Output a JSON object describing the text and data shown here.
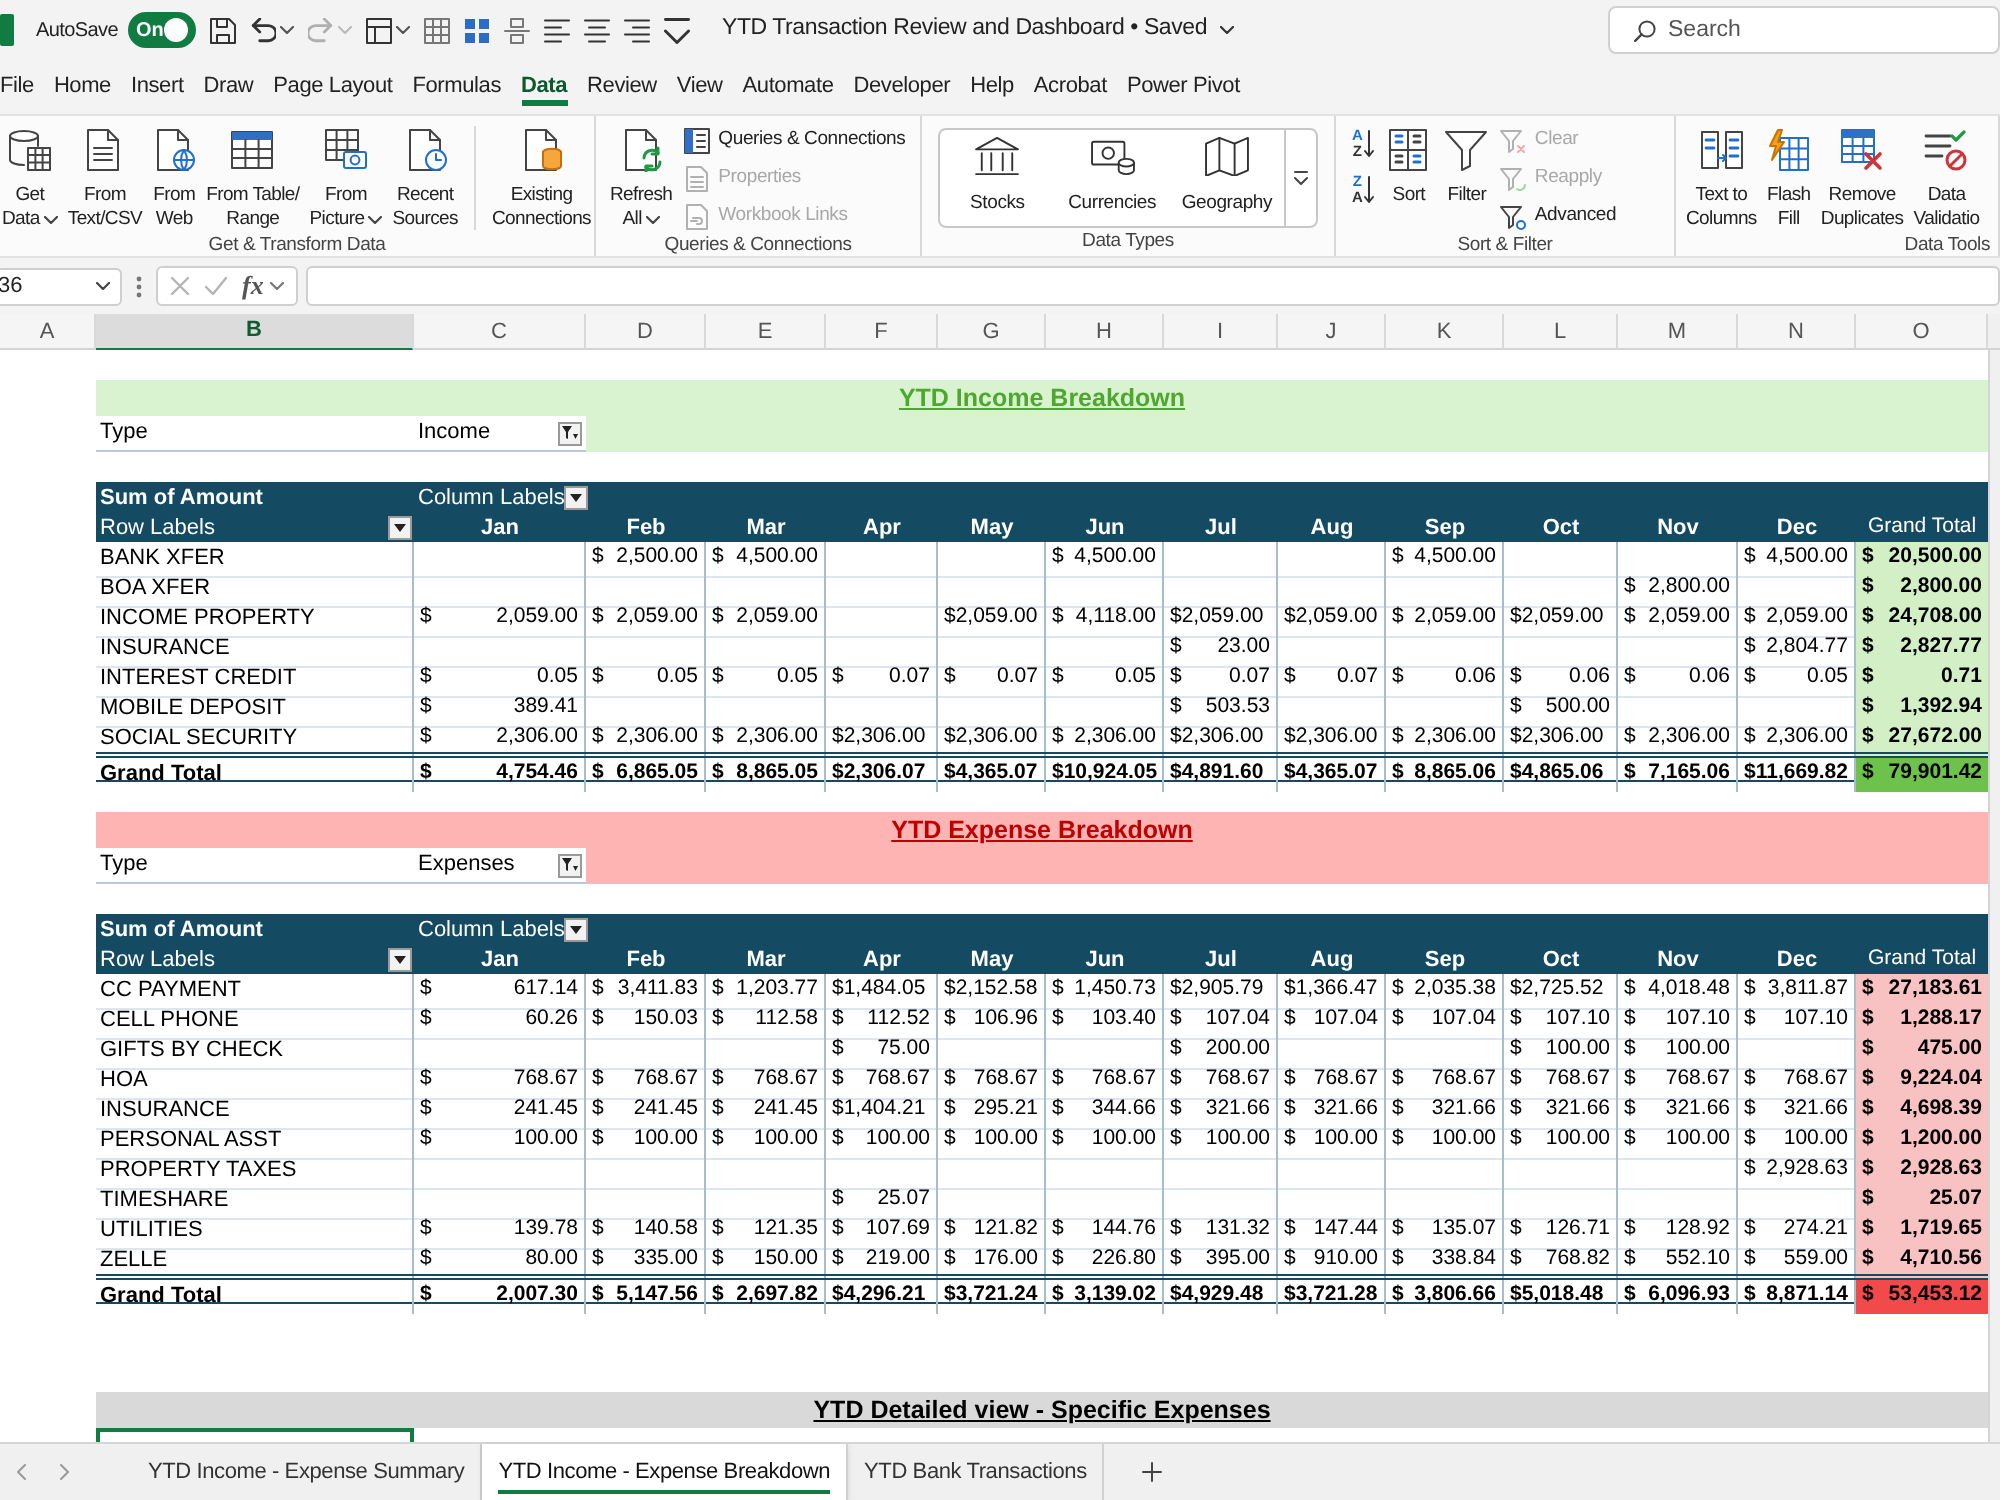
{
  "title_bar": {
    "autosave": {
      "label": "AutoSave",
      "on": true,
      "state_text": "On"
    },
    "quick_access": [
      {
        "dropdown": false,
        "disabled": false
      },
      {
        "dropdown": true,
        "disabled": false
      },
      {
        "dropdown": true,
        "disabled": true
      },
      {
        "dropdown": true,
        "disabled": false
      },
      {
        "dropdown": false,
        "disabled": false
      },
      {
        "dropdown": false,
        "disabled": false
      },
      {
        "dropdown": false,
        "disabled": false
      },
      {
        "dropdown": false,
        "disabled": false
      },
      {
        "dropdown": false,
        "disabled": false
      },
      {
        "dropdown": false,
        "disabled": false
      },
      {
        "dropdown": false,
        "disabled": false
      }
    ],
    "title": "YTD Transaction Review and Dashboard • Saved",
    "search": {
      "placeholder": "Search"
    }
  },
  "menu_tabs": [
    {
      "label": "File",
      "selected": false
    },
    {
      "label": "Home",
      "selected": false
    },
    {
      "label": "Insert",
      "selected": false
    },
    {
      "label": "Draw",
      "selected": false
    },
    {
      "label": "Page Layout",
      "selected": false
    },
    {
      "label": "Formulas",
      "selected": false
    },
    {
      "label": "Data",
      "selected": true
    },
    {
      "label": "Review",
      "selected": false
    },
    {
      "label": "View",
      "selected": false
    },
    {
      "label": "Automate",
      "selected": false
    },
    {
      "label": "Developer",
      "selected": false
    },
    {
      "label": "Help",
      "selected": false
    },
    {
      "label": "Acrobat",
      "selected": false
    },
    {
      "label": "Power Pivot",
      "selected": false
    }
  ],
  "ribbon": {
    "groups": [
      {
        "label": "Get & Transform Data",
        "items": [
          {
            "kind": "large",
            "lines": [
              "Get",
              "Data"
            ],
            "dropdown": true
          },
          {
            "kind": "large",
            "lines": [
              "From",
              "Text/CSV"
            ],
            "dropdown": false
          },
          {
            "kind": "large",
            "lines": [
              "From",
              "Web"
            ],
            "dropdown": false
          },
          {
            "kind": "large",
            "lines": [
              "From Table/",
              "Range"
            ],
            "dropdown": false
          },
          {
            "kind": "large",
            "lines": [
              "From",
              "Picture"
            ],
            "dropdown": true
          },
          {
            "kind": "large",
            "lines": [
              "Recent",
              "Sources"
            ],
            "dropdown": false
          },
          {
            "kind": "separator"
          },
          {
            "kind": "large",
            "lines": [
              "Existing",
              "Connections"
            ],
            "dropdown": false
          }
        ]
      },
      {
        "label": "Queries & Connections",
        "items": [
          {
            "kind": "large",
            "lines": [
              "Refresh",
              "All"
            ],
            "dropdown": true
          },
          {
            "kind": "stack",
            "buttons": [
              {
                "label": "Queries & Connections",
                "disabled": false
              },
              {
                "label": "Properties",
                "disabled": true
              },
              {
                "label": "Workbook Links",
                "disabled": true
              }
            ]
          }
        ]
      },
      {
        "label": "Data Types",
        "items": [
          {
            "kind": "gallery",
            "options": [
              "Stocks",
              "Currencies",
              "Geography"
            ]
          }
        ]
      },
      {
        "label": "Sort & Filter",
        "items": [
          {
            "kind": "sort_pair",
            "buttons": [
              {
                "top": "A",
                "bottom": "Z"
              },
              {
                "top": "Z",
                "bottom": "A"
              }
            ]
          },
          {
            "kind": "large",
            "lines": [
              "Sort"
            ],
            "dropdown": false
          },
          {
            "kind": "large",
            "lines": [
              "Filter"
            ],
            "dropdown": false
          },
          {
            "kind": "stack",
            "buttons": [
              {
                "label": "Clear",
                "disabled": true
              },
              {
                "label": "Reapply",
                "disabled": true
              },
              {
                "label": "Advanced",
                "disabled": false
              }
            ]
          }
        ]
      },
      {
        "label": "Data Tools",
        "items": [
          {
            "kind": "large",
            "lines": [
              "Text to",
              "Columns"
            ],
            "dropdown": false
          },
          {
            "kind": "large",
            "lines": [
              "Flash",
              "Fill"
            ],
            "dropdown": false
          },
          {
            "kind": "large",
            "lines": [
              "Remove",
              "Duplicates"
            ],
            "dropdown": false
          },
          {
            "kind": "large",
            "lines": [
              "Data",
              "Validatio"
            ],
            "dropdown": false
          }
        ]
      }
    ]
  },
  "formula_bar": {
    "name_box": "36",
    "cancel_disabled": true,
    "enter_disabled": true,
    "function_label": "fx"
  },
  "column_headers": [
    {
      "label": "A",
      "selected": false
    },
    {
      "label": "B",
      "selected": true
    },
    {
      "label": "C",
      "selected": false
    },
    {
      "label": "D",
      "selected": false
    },
    {
      "label": "E",
      "selected": false
    },
    {
      "label": "F",
      "selected": false
    },
    {
      "label": "G",
      "selected": false
    },
    {
      "label": "H",
      "selected": false
    },
    {
      "label": "I",
      "selected": false
    },
    {
      "label": "J",
      "selected": false
    },
    {
      "label": "K",
      "selected": false
    },
    {
      "label": "L",
      "selected": false
    },
    {
      "label": "M",
      "selected": false
    },
    {
      "label": "N",
      "selected": false
    },
    {
      "label": "O",
      "selected": false
    }
  ],
  "sections": [
    {
      "kind": "income",
      "title": "YTD Income Breakdown",
      "filter": {
        "label": "Type",
        "value": "Income"
      },
      "pivot": {
        "value_label": "Sum of Amount",
        "column_labels": "Column Labels",
        "row_labels": "Row Labels",
        "columns": [
          "Jan",
          "Feb",
          "Mar",
          "Apr",
          "May",
          "Jun",
          "Jul",
          "Aug",
          "Sep",
          "Oct",
          "Nov",
          "Dec",
          "Grand Total"
        ],
        "rows": [
          {
            "label": "BANK XFER",
            "cells": [
              null,
              "$ 2,500.00",
              "$ 4,500.00",
              null,
              null,
              "$ 4,500.00",
              null,
              null,
              "$ 4,500.00",
              null,
              null,
              "$ 4,500.00",
              "$ 20,500.00"
            ]
          },
          {
            "label": "BOA XFER",
            "cells": [
              null,
              null,
              null,
              null,
              null,
              null,
              null,
              null,
              null,
              null,
              "$ 2,800.00",
              null,
              "$ 2,800.00"
            ]
          },
          {
            "label": "INCOME PROPERTY",
            "cells": [
              "$ 2,059.00",
              "$ 2,059.00",
              "$ 2,059.00",
              null,
              "$2,059.00",
              "$ 4,118.00",
              "$2,059.00",
              "$2,059.00",
              "$ 2,059.00",
              "$2,059.00",
              "$ 2,059.00",
              "$ 2,059.00",
              "$ 24,708.00"
            ]
          },
          {
            "label": "INSURANCE",
            "cells": [
              null,
              null,
              null,
              null,
              null,
              null,
              "$ 23.00",
              null,
              null,
              null,
              null,
              "$ 2,804.77",
              "$ 2,827.77"
            ]
          },
          {
            "label": "INTEREST CREDIT",
            "cells": [
              "$ 0.05",
              "$ 0.05",
              "$ 0.05",
              "$ 0.07",
              "$ 0.07",
              "$ 0.05",
              "$ 0.07",
              "$ 0.07",
              "$ 0.06",
              "$ 0.06",
              "$ 0.06",
              "$ 0.05",
              "$ 0.71"
            ]
          },
          {
            "label": "MOBILE DEPOSIT",
            "cells": [
              "$ 389.41",
              null,
              null,
              null,
              null,
              null,
              "$ 503.53",
              null,
              null,
              "$ 500.00",
              null,
              null,
              "$ 1,392.94"
            ]
          },
          {
            "label": "SOCIAL SECURITY",
            "cells": [
              "$ 2,306.00",
              "$ 2,306.00",
              "$ 2,306.00",
              "$2,306.00",
              "$2,306.00",
              "$ 2,306.00",
              "$2,306.00",
              "$2,306.00",
              "$ 2,306.00",
              "$2,306.00",
              "$ 2,306.00",
              "$ 2,306.00",
              "$ 27,672.00"
            ]
          }
        ],
        "grand_total": {
          "label": "Grand Total",
          "cells": [
            "$ 4,754.46",
            "$ 6,865.05",
            "$ 8,865.05",
            "$2,306.07",
            "$4,365.07",
            "$10,924.05",
            "$4,891.60",
            "$4,365.07",
            "$ 8,865.06",
            "$4,865.06",
            "$ 7,165.06",
            "$11,669.82",
            "$ 79,901.42"
          ]
        }
      }
    },
    {
      "kind": "expense",
      "title": "YTD Expense Breakdown",
      "filter": {
        "label": "Type",
        "value": "Expenses"
      },
      "pivot": {
        "value_label": "Sum of Amount",
        "column_labels": "Column Labels",
        "row_labels": "Row Labels",
        "columns": [
          "Jan",
          "Feb",
          "Mar",
          "Apr",
          "May",
          "Jun",
          "Jul",
          "Aug",
          "Sep",
          "Oct",
          "Nov",
          "Dec",
          "Grand Total"
        ],
        "rows": [
          {
            "label": "CC PAYMENT",
            "cells": [
              "$ 617.14",
              "$ 3,411.83",
              "$ 1,203.77",
              "$1,484.05",
              "$2,152.58",
              "$ 1,450.73",
              "$2,905.79",
              "$1,366.47",
              "$ 2,035.38",
              "$2,725.52",
              "$ 4,018.48",
              "$ 3,811.87",
              "$ 27,183.61"
            ]
          },
          {
            "label": "CELL PHONE",
            "cells": [
              "$ 60.26",
              "$ 150.03",
              "$ 112.58",
              "$ 112.52",
              "$ 106.96",
              "$ 103.40",
              "$ 107.04",
              "$ 107.04",
              "$ 107.04",
              "$ 107.10",
              "$ 107.10",
              "$ 107.10",
              "$ 1,288.17"
            ]
          },
          {
            "label": "GIFTS BY CHECK",
            "cells": [
              null,
              null,
              null,
              "$ 75.00",
              null,
              null,
              "$ 200.00",
              null,
              null,
              "$ 100.00",
              "$ 100.00",
              null,
              "$ 475.00"
            ]
          },
          {
            "label": "HOA",
            "cells": [
              "$ 768.67",
              "$ 768.67",
              "$ 768.67",
              "$ 768.67",
              "$ 768.67",
              "$ 768.67",
              "$ 768.67",
              "$ 768.67",
              "$ 768.67",
              "$ 768.67",
              "$ 768.67",
              "$ 768.67",
              "$ 9,224.04"
            ]
          },
          {
            "label": "INSURANCE",
            "cells": [
              "$ 241.45",
              "$ 241.45",
              "$ 241.45",
              "$1,404.21",
              "$ 295.21",
              "$ 344.66",
              "$ 321.66",
              "$ 321.66",
              "$ 321.66",
              "$ 321.66",
              "$ 321.66",
              "$ 321.66",
              "$ 4,698.39"
            ]
          },
          {
            "label": "PERSONAL ASST",
            "cells": [
              "$ 100.00",
              "$ 100.00",
              "$ 100.00",
              "$ 100.00",
              "$ 100.00",
              "$ 100.00",
              "$ 100.00",
              "$ 100.00",
              "$ 100.00",
              "$ 100.00",
              "$ 100.00",
              "$ 100.00",
              "$ 1,200.00"
            ]
          },
          {
            "label": "PROPERTY TAXES",
            "cells": [
              null,
              null,
              null,
              null,
              null,
              null,
              null,
              null,
              null,
              null,
              null,
              "$ 2,928.63",
              "$ 2,928.63"
            ]
          },
          {
            "label": "TIMESHARE",
            "cells": [
              null,
              null,
              null,
              "$ 25.07",
              null,
              null,
              null,
              null,
              null,
              null,
              null,
              null,
              "$ 25.07"
            ]
          },
          {
            "label": "UTILITIES",
            "cells": [
              "$ 139.78",
              "$ 140.58",
              "$ 121.35",
              "$ 107.69",
              "$ 121.82",
              "$ 144.76",
              "$ 131.32",
              "$ 147.44",
              "$ 135.07",
              "$ 126.71",
              "$ 128.92",
              "$ 274.21",
              "$ 1,719.65"
            ]
          },
          {
            "label": "ZELLE",
            "cells": [
              "$ 80.00",
              "$ 335.00",
              "$ 150.00",
              "$ 219.00",
              "$ 176.00",
              "$ 226.80",
              "$ 395.00",
              "$ 910.00",
              "$ 338.84",
              "$ 768.82",
              "$ 552.10",
              "$ 559.00",
              "$ 4,710.56"
            ]
          }
        ],
        "grand_total": {
          "label": "Grand Total",
          "cells": [
            "$ 2,007.30",
            "$ 5,147.56",
            "$ 2,697.82",
            "$4,296.21",
            "$3,721.24",
            "$ 3,139.02",
            "$4,929.48",
            "$3,721.28",
            "$ 3,806.66",
            "$5,018.48",
            "$ 6,096.93",
            "$ 8,871.14",
            "$ 53,453.12"
          ]
        }
      }
    },
    {
      "kind": "detail",
      "title": "YTD Detailed view - Specific Expenses",
      "first_cell_selected": true
    }
  ],
  "sheet_tabs": [
    {
      "label": "YTD Income - Expense Summary",
      "selected": false
    },
    {
      "label": "YTD Income - Expense Breakdown",
      "selected": true
    },
    {
      "label": "YTD Bank Transactions",
      "selected": false
    }
  ]
}
